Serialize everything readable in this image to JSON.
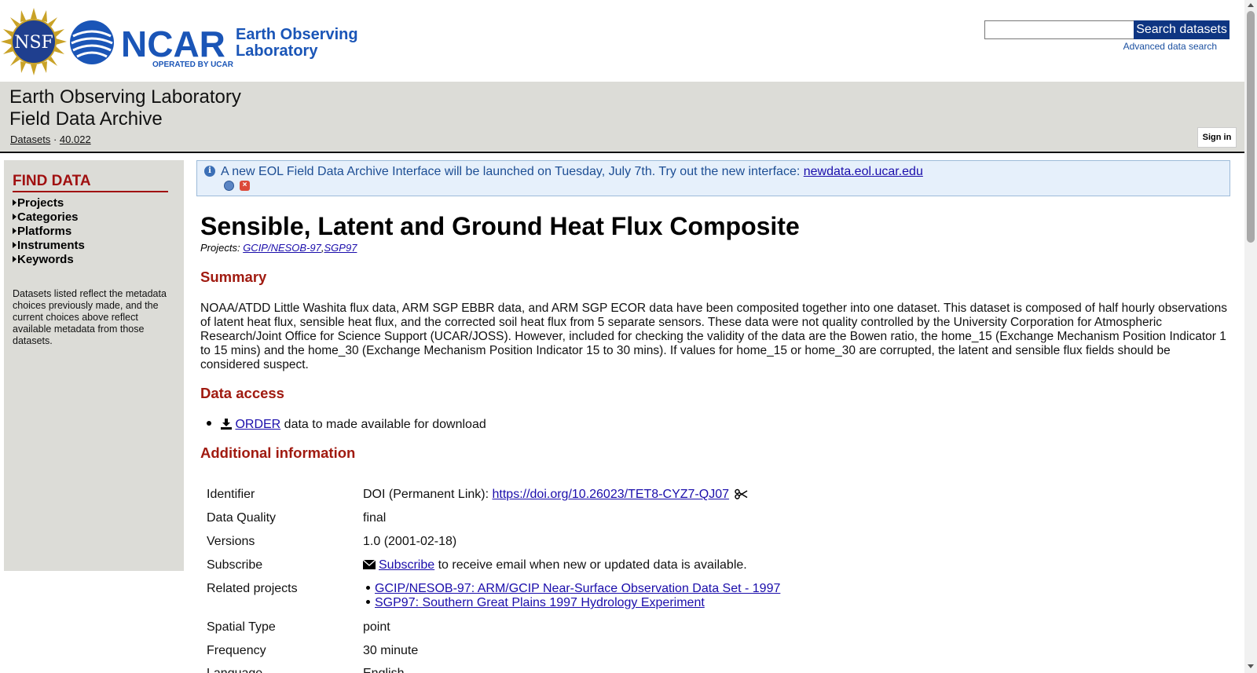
{
  "header": {
    "logo_nsf_text": "NSF",
    "logo_ncar_text": "NCAR",
    "logo_eol_line1": "Earth Observing",
    "logo_eol_line2": "Laboratory",
    "logo_operated": "OPERATED BY UCAR",
    "search_placeholder": "",
    "search_button": "Search datasets",
    "advanced_search": "Advanced data search"
  },
  "title_band": {
    "line1": "Earth Observing Laboratory",
    "line2": "Field Data Archive",
    "breadcrumbs": [
      {
        "label": "Datasets"
      },
      {
        "label": "40.022"
      }
    ],
    "separator": "·",
    "sign_in": "Sign in"
  },
  "sidebar": {
    "title": "FIND DATA",
    "items": [
      {
        "label": "Projects"
      },
      {
        "label": "Categories"
      },
      {
        "label": "Platforms"
      },
      {
        "label": "Instruments"
      },
      {
        "label": "Keywords"
      }
    ],
    "note": "Datasets listed reflect the metadata choices previously made, and the current choices above reflect available metadata from those datasets."
  },
  "notice": {
    "text": "A new EOL Field Data Archive Interface will be launched on Tuesday, July 7th. Try out the new interface: ",
    "link": "newdata.eol.ucar.edu"
  },
  "dataset": {
    "title": "Sensible, Latent and Ground Heat Flux Composite",
    "projects_label": "Projects: ",
    "projects": [
      "GCIP/NESOB-97",
      "SGP97"
    ],
    "summary_heading": "Summary",
    "summary": "NOAA/ATDD Little Washita flux data, ARM SGP EBBR data, and ARM SGP ECOR data have been composited together into one dataset. This dataset is composed of half hourly observations of latent heat flux, sensible heat flux, and the corrected soil heat flux from 5 separate sensors. These data were not quality controlled by the University Corporation for Atmospheric Research/Joint Office for Science Support (UCAR/JOSS). However, included for checking the validity of the data are the Bowen ratio, the home_15 (Exchange Mechanism Position Indicator 1 to 15 mins) and the home_30 (Exchange Mechanism Position Indicator 15 to 30 mins). If values for home_15 or home_30 are corrupted, the latent and sensible flux fields should be considered suspect.",
    "access_heading": "Data access",
    "order_link": "ORDER",
    "order_text": " data to made available for download",
    "additional_heading": "Additional information",
    "info": {
      "identifier_label": "Identifier",
      "identifier_prefix": "DOI (Permanent Link): ",
      "identifier_link": "https://doi.org/10.26023/TET8-CYZ7-QJ07",
      "quality_label": "Data Quality",
      "quality_value": "final",
      "versions_label": "Versions",
      "versions_value": "1.0 (2001-02-18)",
      "subscribe_label": "Subscribe",
      "subscribe_link": "Subscribe",
      "subscribe_text": " to receive email when new or updated data is available.",
      "related_label": "Related projects",
      "related": [
        "GCIP/NESOB-97: ARM/GCIP Near-Surface Observation Data Set - 1997",
        "SGP97: Southern Great Plains 1997 Hydrology Experiment"
      ],
      "spatial_label": "Spatial Type",
      "spatial_value": "point",
      "frequency_label": "Frequency",
      "frequency_value": "30 minute",
      "language_label": "Language",
      "language_value": "English"
    }
  },
  "colors": {
    "accent_red": "#a01a10",
    "band_gray": "#dcdcd7",
    "search_button": "#0e3582",
    "link": "#1a0dab"
  }
}
